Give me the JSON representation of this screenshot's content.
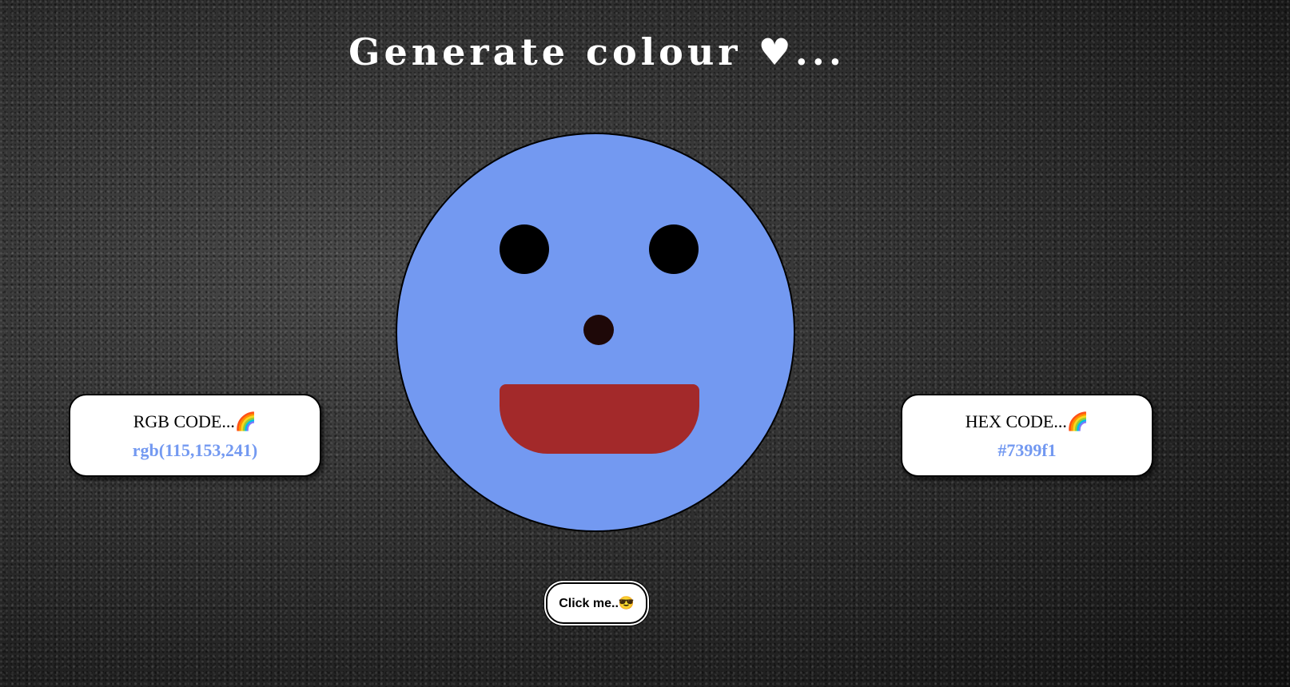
{
  "header": {
    "title": "Generate colour ♥..."
  },
  "face": {
    "color": "#7399f1",
    "eye_color": "#000000",
    "nose_color": "#1e0808",
    "mouth_color": "#a3292a"
  },
  "rgb_card": {
    "title": "RGB CODE...🌈",
    "value": "rgb(115,153,241)"
  },
  "hex_card": {
    "title": "HEX CODE...🌈",
    "value": "#7399f1"
  },
  "button": {
    "label": "Click me..😎"
  }
}
